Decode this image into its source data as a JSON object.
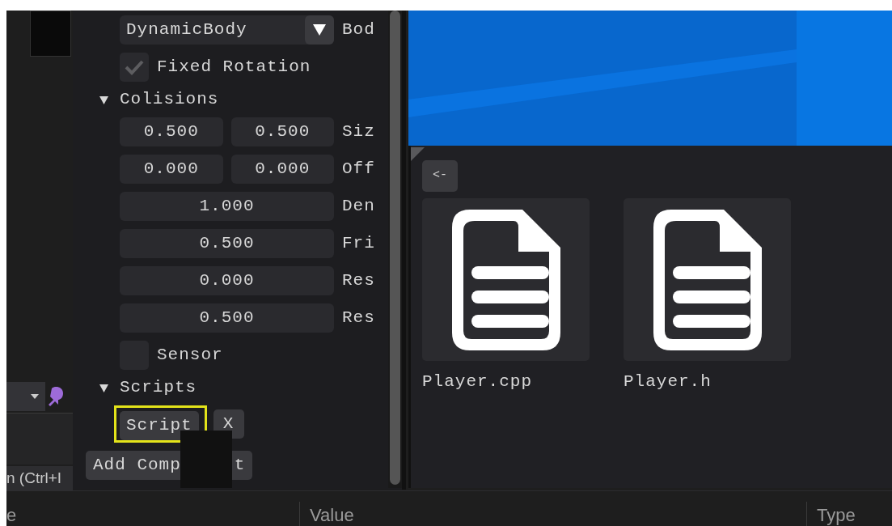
{
  "body_type": {
    "value": "DynamicBody",
    "label": "Bod"
  },
  "fixed_rotation": {
    "label": "Fixed Rotation",
    "checked": true
  },
  "colisions": {
    "title": "Colisions",
    "expanded": true,
    "rows": [
      {
        "values": [
          "0.500",
          "0.500"
        ],
        "label": "Siz"
      },
      {
        "values": [
          "0.000",
          "0.000"
        ],
        "label": "Off"
      },
      {
        "values": [
          "1.000"
        ],
        "label": "Den"
      },
      {
        "values": [
          "0.500"
        ],
        "label": "Fri"
      },
      {
        "values": [
          "0.000"
        ],
        "label": "Res"
      },
      {
        "values": [
          "0.500"
        ],
        "label": "Res"
      }
    ]
  },
  "sensor": {
    "label": "Sensor",
    "checked": false
  },
  "scripts": {
    "title": "Scripts",
    "expanded": true,
    "items": [
      {
        "label": "Script",
        "remove": "X",
        "highlighted": true
      }
    ]
  },
  "add_component": [
    "Add Comp",
    "t"
  ],
  "asset_browser": {
    "back": "<-",
    "files": [
      {
        "name": "Player.cpp"
      },
      {
        "name": "Player.h"
      }
    ]
  },
  "background": {
    "search_hint": "n (Ctrl+I",
    "columns": [
      "e",
      "Value",
      "Type"
    ]
  }
}
